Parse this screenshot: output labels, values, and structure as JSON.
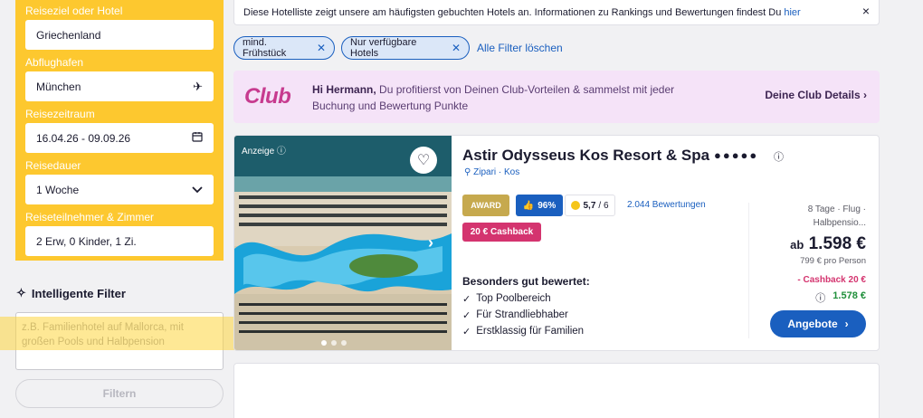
{
  "search": {
    "destination_label": "Reiseziel oder Hotel",
    "destination_value": "Griechenland",
    "airport_label": "Abflughafen",
    "airport_value": "München",
    "period_label": "Reisezeitraum",
    "period_value": "16.04.26 - 09.09.26",
    "duration_label": "Reisedauer",
    "duration_value": "1 Woche",
    "travelers_label": "Reiseteilnehmer & Zimmer",
    "travelers_value": "2 Erw, 0 Kinder, 1 Zi."
  },
  "smart_filter": {
    "title": "Intelligente Filter",
    "placeholder": "z.B. Familienhotel auf Mallorca, mit großen Pools und Halbpension",
    "button_label": "Filtern"
  },
  "info_banner": {
    "text": "Diese Hotelliste zeigt unsere am häufigsten gebuchten Hotels an. Informationen zu Rankings und Bewertungen findest Du",
    "link": "hier",
    "close": "×"
  },
  "chips": [
    {
      "label": "mind. Frühstück"
    },
    {
      "label": "Nur verfügbare Hotels"
    }
  ],
  "clear_filters": "Alle Filter löschen",
  "club": {
    "logo": "Club",
    "greeting": "Hi Hermann,",
    "text": " Du profitierst von Deinen Club-Vorteilen & sammelst mit jeder Buchung und Bewertung Punkte",
    "details_link": "Deine Club Details ›"
  },
  "hotel": {
    "ad_label": "Anzeige ⓘ",
    "name": "Astir Odysseus Kos Resort & Spa",
    "stars": "●●●●●",
    "info_icon": "ⓘ",
    "location": "Zipari · Kos",
    "award": "AWARD",
    "recommend": "96%",
    "rating": "5,7",
    "rating_max": "/ 6",
    "reviews": "2.044 Bewertungen",
    "cashback_badge": "20 € Cashback",
    "best_rated_title": "Besonders gut bewertet:",
    "features": [
      "Top Poolbereich",
      "Für Strandliebhaber",
      "Erstklassig für Familien"
    ],
    "travel_summary": "8 Tage · Flug · Halbpensio...",
    "price_prefix": "ab",
    "price": "1.598 €",
    "price_pp": "799 € pro Person",
    "cashback_line": "- Cashback 20 €",
    "final_price": "1.578 €",
    "offers_button": "Angebote"
  },
  "icons": {
    "plane": "plane-icon",
    "calendar": "calendar-icon",
    "chevron": "chevron-down-icon",
    "sparkle": "sparkle-icon",
    "heart": "heart-icon",
    "thumb": "thumbs-up-icon",
    "pin": "location-pin-icon"
  },
  "colors": {
    "search_panel": "#fdc82f",
    "primary_blue": "#1a5fbf",
    "club_pink": "#c73b8f",
    "cashback_pink": "#d4346f",
    "award_gold": "#c6a94e",
    "final_green": "#1f8f3a"
  }
}
